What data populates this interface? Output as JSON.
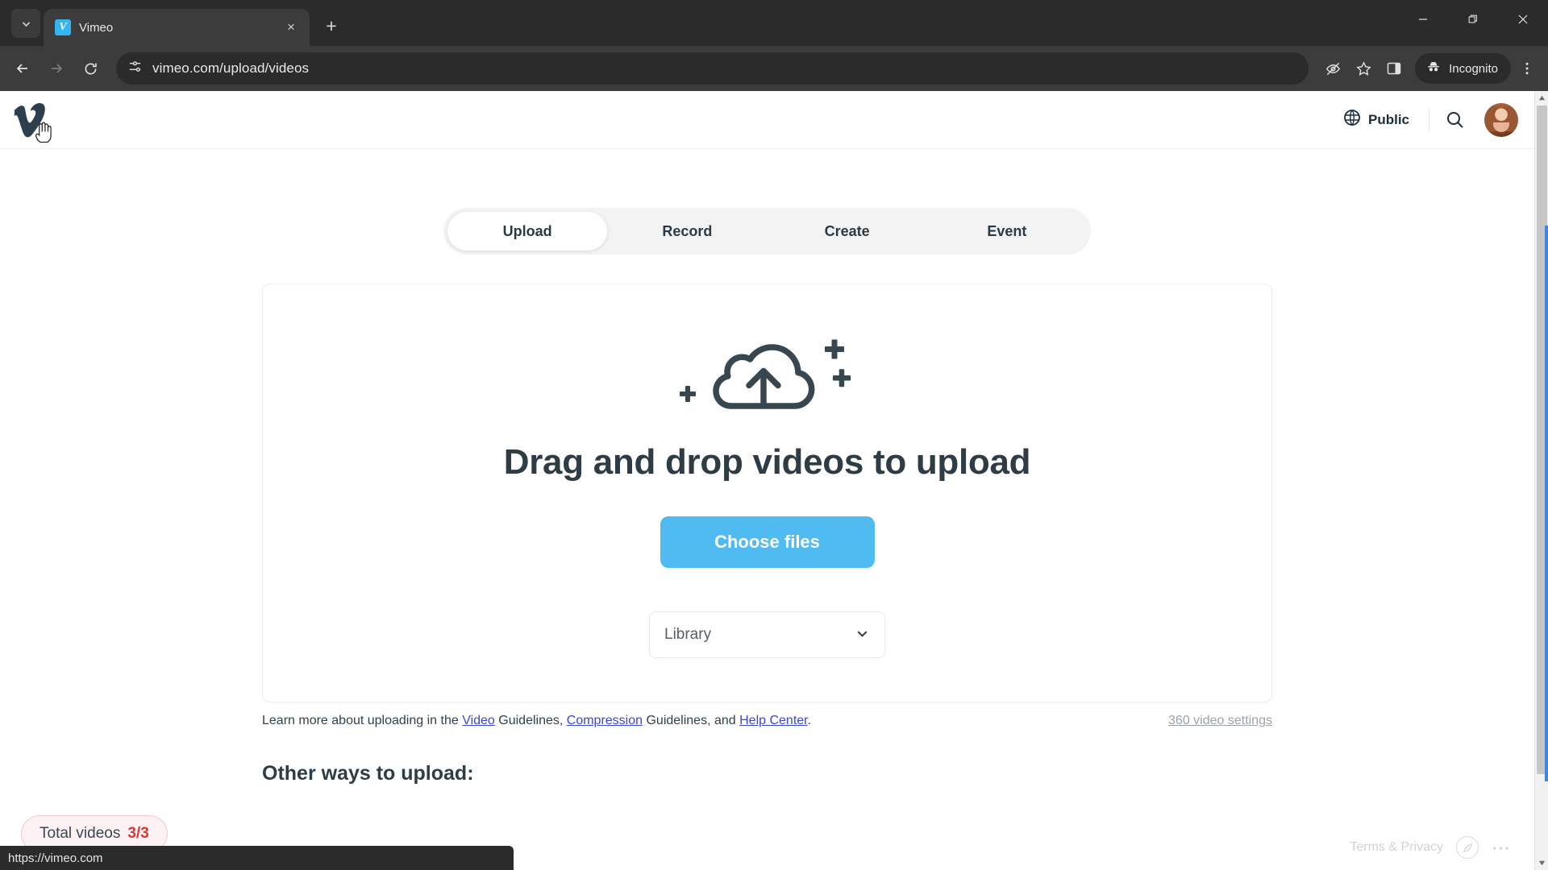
{
  "browser": {
    "tab": {
      "title": "Vimeo",
      "favicon_letter": "V",
      "close_label": "×"
    },
    "tab_list_icon": "chevron-down-icon",
    "new_tab_label": "+",
    "window_controls": {
      "minimize": "—",
      "maximize": "❐",
      "close": "✕"
    },
    "nav": {
      "back": "←",
      "forward": "→",
      "reload": "⟳"
    },
    "omnibox": {
      "url": "vimeo.com/upload/videos",
      "site_info_icon": "tune-icon"
    },
    "toolbar_icons": [
      "eye-off-icon",
      "star-icon",
      "side-panel-icon"
    ],
    "incognito_label": "Incognito",
    "menu_icon": "kebab-menu-icon",
    "status_bar_url": "https://vimeo.com"
  },
  "site_header": {
    "logo_alt": "Vimeo",
    "privacy_chip": {
      "label": "Public",
      "icon": "globe-icon"
    },
    "search_icon": "search-icon",
    "avatar_alt": "user avatar"
  },
  "main": {
    "tabs": [
      {
        "label": "Upload",
        "active": true
      },
      {
        "label": "Record",
        "active": false
      },
      {
        "label": "Create",
        "active": false
      },
      {
        "label": "Event",
        "active": false
      }
    ],
    "dropzone": {
      "icon": "cloud-upload-icon",
      "title": "Drag and drop videos to upload",
      "button_label": "Choose files",
      "destination_select": {
        "value": "Library",
        "chevron": "⌄"
      }
    },
    "learn_more": {
      "prefix": "Learn more about uploading in the ",
      "link1": "Video",
      "mid1": " Guidelines, ",
      "link2": "Compression",
      "mid2": " Guidelines, and ",
      "link3": "Help Center",
      "suffix": "."
    },
    "settings_360_label": "360 video settings",
    "other_ways_title": "Other ways to upload:"
  },
  "floating": {
    "total_videos": {
      "label": "Total videos",
      "count": "3/3"
    },
    "terms_label": "Terms & Privacy",
    "circle_icon": "feather-circle-icon",
    "dots_icon": "more-dots-icon"
  },
  "colors": {
    "accent_blue": "#4fbbf0",
    "link_blue": "#3a46d6",
    "alert_red": "#e0342c",
    "chrome_dark": "#2b2b2b",
    "text_dark": "#2e3c45"
  }
}
